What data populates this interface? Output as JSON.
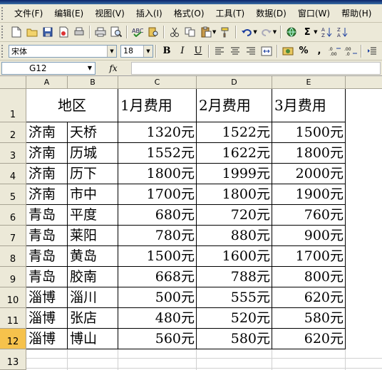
{
  "menubar": {
    "items": [
      "文件(F)",
      "编辑(E)",
      "视图(V)",
      "插入(I)",
      "格式(O)",
      "工具(T)",
      "数据(D)",
      "窗口(W)",
      "帮助(H)"
    ]
  },
  "toolbar": {
    "font_name": "宋体",
    "font_size": "18",
    "bold": "B",
    "italic": "I",
    "underline": "U",
    "percent": "%",
    "comma": ",",
    "sum": "Σ"
  },
  "formula_bar": {
    "name_box": "G12",
    "fx_label": "fx",
    "content": ""
  },
  "sheet": {
    "col_headers": [
      "A",
      "B",
      "C",
      "D",
      "E"
    ],
    "row_headers": [
      "1",
      "2",
      "3",
      "4",
      "5",
      "6",
      "7",
      "8",
      "9",
      "10",
      "11",
      "12",
      "13"
    ],
    "active_row": "12",
    "header_row": [
      "地区",
      "1月费用",
      "2月费用",
      "3月费用"
    ],
    "rows": [
      [
        "济南",
        "天桥",
        "1320元",
        "1522元",
        "1500元"
      ],
      [
        "济南",
        "历城",
        "1552元",
        "1622元",
        "1800元"
      ],
      [
        "济南",
        "历下",
        "1800元",
        "1999元",
        "2000元"
      ],
      [
        "济南",
        "市中",
        "1700元",
        "1800元",
        "1900元"
      ],
      [
        "青岛",
        "平度",
        "680元",
        "720元",
        "760元"
      ],
      [
        "青岛",
        "莱阳",
        "780元",
        "880元",
        "900元"
      ],
      [
        "青岛",
        "黄岛",
        "1500元",
        "1600元",
        "1700元"
      ],
      [
        "青岛",
        "胶南",
        "668元",
        "788元",
        "800元"
      ],
      [
        "淄博",
        "淄川",
        "500元",
        "555元",
        "620元"
      ],
      [
        "淄博",
        "张店",
        "480元",
        "520元",
        "580元"
      ],
      [
        "淄博",
        "博山",
        "560元",
        "580元",
        "620元"
      ]
    ]
  }
}
